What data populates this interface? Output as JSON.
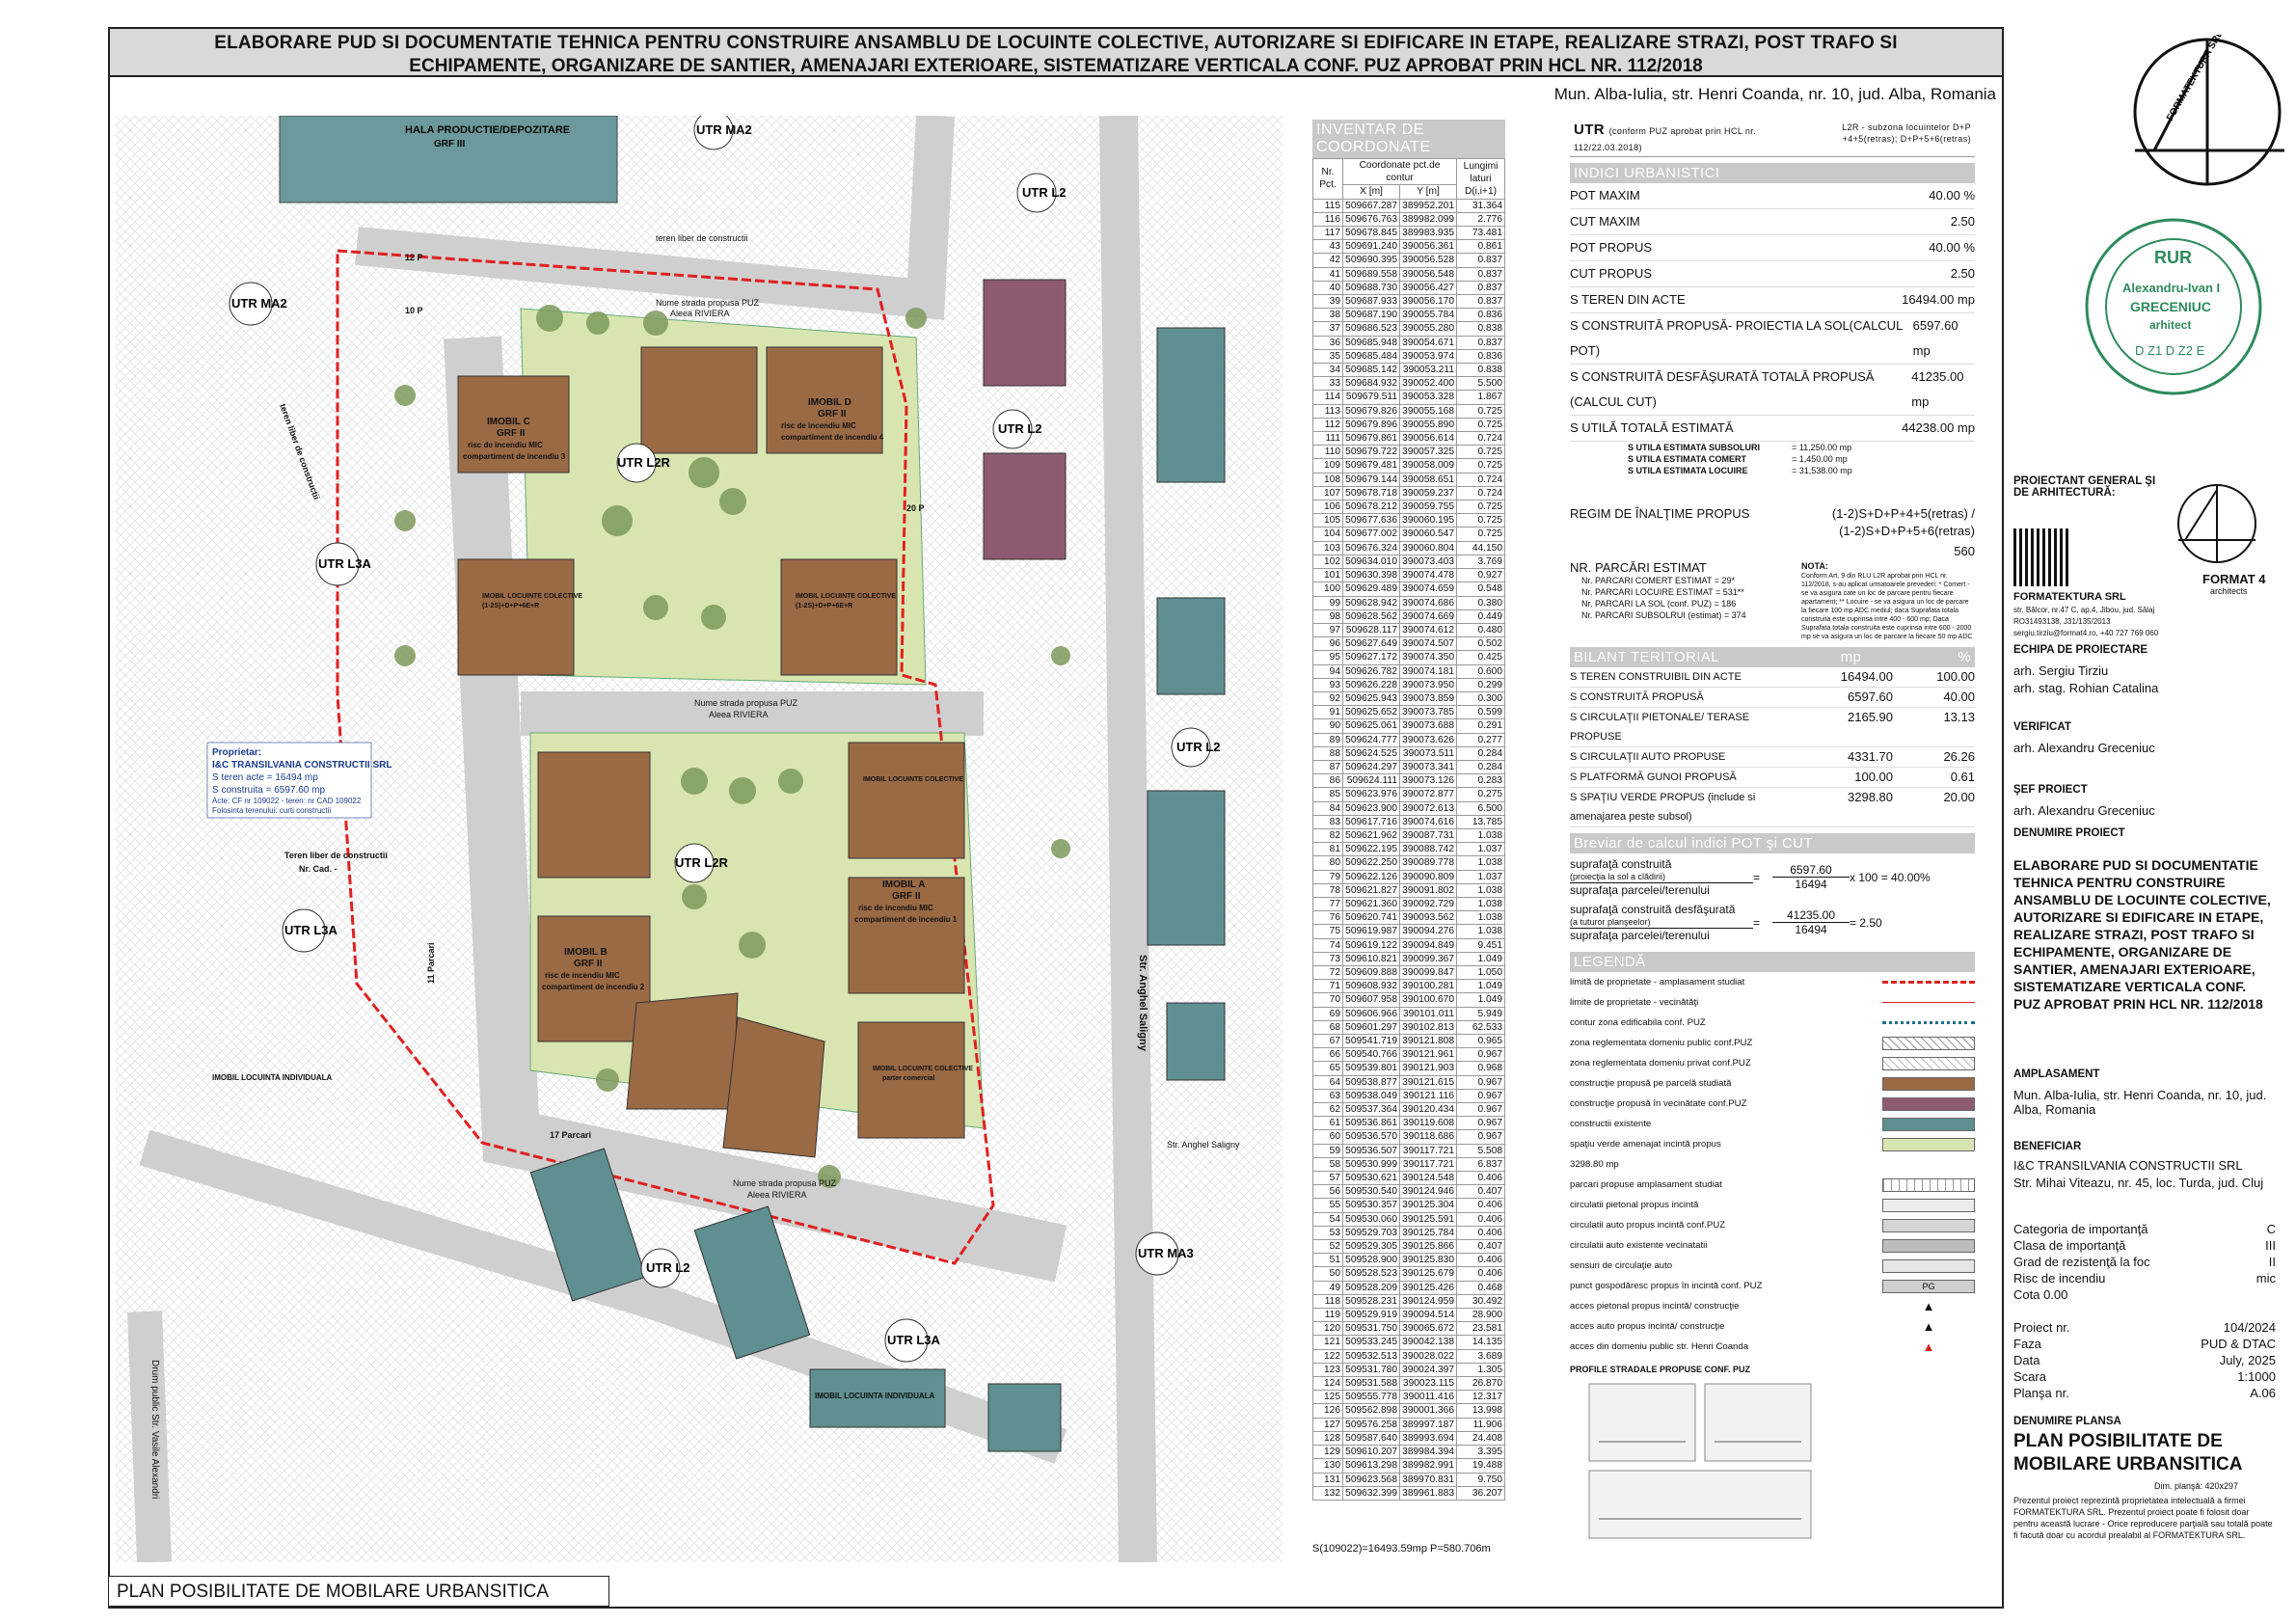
{
  "header": {
    "line1": "ELABORARE PUD SI DOCUMENTATIE TEHNICA PENTRU CONSTRUIRE ANSAMBLU DE LOCUINTE COLECTIVE, AUTORIZARE SI EDIFICARE IN ETAPE, REALIZARE STRAZI, POST TRAFO SI",
    "line2": "ECHIPAMENTE, ORGANIZARE DE SANTIER, AMENAJARI EXTERIOARE, SISTEMATIZARE VERTICALA CONF. PUZ APROBAT PRIN HCL NR. 112/2018",
    "location": "Mun. Alba-Iulia, str. Henri Coanda, nr. 10, jud. Alba, Romania"
  },
  "map": {
    "labels": {
      "hala": "HALA PRODUCTIE/DEPOZITARE",
      "hala_grf": "GRF III",
      "utr_ma2_top": "UTR MA2",
      "utr_ma2_left": "UTR MA2",
      "utr_l2_top": "UTR L2",
      "utr_l2_mid": "UTR L2",
      "utr_l2_right": "UTR L2",
      "utr_l2_bottom": "UTR L2",
      "utr_l3a_left": "UTR L3A",
      "utr_l3a_mid": "UTR L3A",
      "utr_l3a_bottom": "UTR L3A",
      "utr_ma3": "UTR MA3",
      "utr_l2r_top": "UTR L2R",
      "utr_l2r_bottom": "UTR L2R",
      "teren_liber_top": "teren liber de constructii",
      "teren_liber_left": "teren liber de constructii",
      "teren_liber_mid": "Teren liber de constructii",
      "nr_cad": "Nr. Cad. -",
      "strada_propusa_1": "Nume strada propusa PUZ",
      "alee_riviera_1": "Aleea RIVIERA",
      "strada_propusa_2": "Nume strada propusa PUZ",
      "alee_riviera_2": "Aleea RIVIERA",
      "strada_propusa_3": "Nume strada propusa PUZ",
      "alee_riviera_3": "Aleea RIVIERA",
      "str_anghel": "Str. Anghel Saligny",
      "str_anghel_2": "Str. Anghel Saligny",
      "drum_public": "Drum public Str. Vasile Alexandri",
      "imobil_c": "IMOBIL C",
      "imobil_d": "IMOBIL D",
      "imobil_b": "IMOBIL B",
      "imobil_a": "IMOBIL A",
      "grf2": "GRF II",
      "risc": "risc de incendiu MIC",
      "comp3": "compartiment de incendiu 3",
      "comp4": "compartiment de incendiu 4",
      "comp2": "compartiment de incendiu 2",
      "comp1": "compartiment de incendiu 1",
      "imobil_locuinte": "IMOBIL LOCUINTE COLECTIVE",
      "regim": "(1-2S)+D+P+6E+R",
      "parter_comercial": "parter comercial",
      "imobil_ind": "IMOBIL LOCUINTA INDIVIDUALA",
      "proprietar_title": "Proprietar:",
      "proprietar_name": "I&C TRANSILVANIA CONSTRUCTII SRL",
      "proprietar_s_teren": "S teren acte = 16494 mp",
      "proprietar_s_construita": "S construita = 6597.60 mp",
      "proprietar_cf": "Acte: CF nr 109022 - teren: nr CAD 109022",
      "proprietar_folosinta": "Folosinta terenului: curti constructii",
      "p12": "12 P",
      "p10": "10 P",
      "p20": "20 P",
      "p11": "11 Parcari",
      "p17": "17 Parcari"
    }
  },
  "coord": {
    "title": "INVENTAR DE COORDONATE",
    "h_nr": "Nr. Pct.",
    "h_coord": "Coordonate pct.de contur",
    "h_x": "X [m]",
    "h_y": "Y [m]",
    "h_len": "Lungimi laturi D(i,i+1)",
    "rows": [
      [
        "115",
        "509667.287",
        "389952.201",
        "31.364"
      ],
      [
        "116",
        "509676.763",
        "389982.099",
        "2.776"
      ],
      [
        "117",
        "509678.845",
        "389983.935",
        "73.481"
      ],
      [
        "43",
        "509691.240",
        "390056.361",
        "0.861"
      ],
      [
        "42",
        "509690.395",
        "390056.528",
        "0.837"
      ],
      [
        "41",
        "509689.558",
        "390056.548",
        "0.837"
      ],
      [
        "40",
        "509688.730",
        "390056.427",
        "0.837"
      ],
      [
        "39",
        "509687.933",
        "390056.170",
        "0.837"
      ],
      [
        "38",
        "509687.190",
        "390055.784",
        "0.836"
      ],
      [
        "37",
        "509686.523",
        "390055.280",
        "0.838"
      ],
      [
        "36",
        "509685.948",
        "390054.671",
        "0.837"
      ],
      [
        "35",
        "509685.484",
        "390053.974",
        "0.836"
      ],
      [
        "34",
        "509685.142",
        "390053.211",
        "0.838"
      ],
      [
        "33",
        "509684.932",
        "390052.400",
        "5.500"
      ],
      [
        "114",
        "509679.511",
        "390053.328",
        "1.867"
      ],
      [
        "113",
        "509679.826",
        "390055.168",
        "0.725"
      ],
      [
        "112",
        "509679.896",
        "390055.890",
        "0.725"
      ],
      [
        "111",
        "509679.861",
        "390056.614",
        "0.724"
      ],
      [
        "110",
        "509679.722",
        "390057.325",
        "0.725"
      ],
      [
        "109",
        "509679.481",
        "390058.009",
        "0.725"
      ],
      [
        "108",
        "509679.144",
        "390058.651",
        "0.724"
      ],
      [
        "107",
        "509678.718",
        "390059.237",
        "0.724"
      ],
      [
        "106",
        "509678.212",
        "390059.755",
        "0.725"
      ],
      [
        "105",
        "509677.636",
        "390060.195",
        "0.725"
      ],
      [
        "104",
        "509677.002",
        "390060.547",
        "0.725"
      ],
      [
        "103",
        "509676.324",
        "390060.804",
        "44.150"
      ],
      [
        "102",
        "509634.010",
        "390073.403",
        "3.769"
      ],
      [
        "101",
        "509630.398",
        "390074.478",
        "0.927"
      ],
      [
        "100",
        "509629.489",
        "390074.659",
        "0.548"
      ],
      [
        "99",
        "509628.942",
        "390074.686",
        "0.380"
      ],
      [
        "98",
        "509628.562",
        "390074.669",
        "0.449"
      ],
      [
        "97",
        "509628.117",
        "390074.612",
        "0.480"
      ],
      [
        "96",
        "509627.649",
        "390074.507",
        "0.502"
      ],
      [
        "95",
        "509627.172",
        "390074.350",
        "0.425"
      ],
      [
        "94",
        "509626.782",
        "390074.181",
        "0.600"
      ],
      [
        "93",
        "509626.228",
        "390073.950",
        "0.299"
      ],
      [
        "92",
        "509625.943",
        "390073.859",
        "0.300"
      ],
      [
        "91",
        "509625.652",
        "390073.785",
        "0.599"
      ],
      [
        "90",
        "509625.061",
        "390073.688",
        "0.291"
      ],
      [
        "89",
        "509624.777",
        "390073.626",
        "0.277"
      ],
      [
        "88",
        "509624.525",
        "390073.511",
        "0.284"
      ],
      [
        "87",
        "509624.297",
        "390073.341",
        "0.284"
      ],
      [
        "86",
        "509624.111",
        "390073.126",
        "0.283"
      ],
      [
        "85",
        "509623.976",
        "390072.877",
        "0.275"
      ],
      [
        "84",
        "509623.900",
        "390072.613",
        "6.500"
      ],
      [
        "83",
        "509617.716",
        "390074.616",
        "13.785"
      ],
      [
        "82",
        "509621.962",
        "390087.731",
        "1.038"
      ],
      [
        "81",
        "509622.195",
        "390088.742",
        "1.037"
      ],
      [
        "80",
        "509622.250",
        "390089.778",
        "1.038"
      ],
      [
        "79",
        "509622.126",
        "390090.809",
        "1.037"
      ],
      [
        "78",
        "509621.827",
        "390091.802",
        "1.038"
      ],
      [
        "77",
        "509621.360",
        "390092.729",
        "1.038"
      ],
      [
        "76",
        "509620.741",
        "390093.562",
        "1.038"
      ],
      [
        "75",
        "509619.987",
        "390094.276",
        "1.038"
      ],
      [
        "74",
        "509619.122",
        "390094.849",
        "9.451"
      ],
      [
        "73",
        "509610.821",
        "390099.367",
        "1.049"
      ],
      [
        "72",
        "509609.888",
        "390099.847",
        "1.050"
      ],
      [
        "71",
        "509608.932",
        "390100.281",
        "1.049"
      ],
      [
        "70",
        "509607.958",
        "390100.670",
        "1.049"
      ],
      [
        "69",
        "509606.966",
        "390101.011",
        "5.949"
      ],
      [
        "68",
        "509601.297",
        "390102.813",
        "62.533"
      ],
      [
        "67",
        "509541.719",
        "390121.808",
        "0.965"
      ],
      [
        "66",
        "509540.766",
        "390121.961",
        "0.967"
      ],
      [
        "65",
        "509539.801",
        "390121.903",
        "0.968"
      ],
      [
        "64",
        "509538.877",
        "390121.615",
        "0.967"
      ],
      [
        "63",
        "509538.049",
        "390121.116",
        "0.967"
      ],
      [
        "62",
        "509537.364",
        "390120.434",
        "0.967"
      ],
      [
        "61",
        "509536.861",
        "390119.608",
        "0.967"
      ],
      [
        "60",
        "509536.570",
        "390118.686",
        "0.967"
      ],
      [
        "59",
        "509536.507",
        "390117.721",
        "5.508"
      ],
      [
        "58",
        "509530.999",
        "390117.721",
        "6.837"
      ],
      [
        "57",
        "509530.621",
        "390124.548",
        "0.406"
      ],
      [
        "56",
        "509530.540",
        "390124.946",
        "0.407"
      ],
      [
        "55",
        "509530.357",
        "390125.304",
        "0.406"
      ],
      [
        "54",
        "509530.060",
        "390125.591",
        "0.406"
      ],
      [
        "53",
        "509529.703",
        "390125.784",
        "0.406"
      ],
      [
        "52",
        "509529.305",
        "390125.866",
        "0.407"
      ],
      [
        "51",
        "509528.900",
        "390125.830",
        "0.406"
      ],
      [
        "50",
        "509528.523",
        "390125.679",
        "0.406"
      ],
      [
        "49",
        "509528.209",
        "390125.426",
        "0.468"
      ],
      [
        "118",
        "509528.231",
        "390124.959",
        "30.492"
      ],
      [
        "119",
        "509529.919",
        "390094.514",
        "28.900"
      ],
      [
        "120",
        "509531.750",
        "390065.672",
        "23.581"
      ],
      [
        "121",
        "509533.245",
        "390042.138",
        "14.135"
      ],
      [
        "122",
        "509532.513",
        "390028.022",
        "3.689"
      ],
      [
        "123",
        "509531.780",
        "390024.397",
        "1.305"
      ],
      [
        "124",
        "509531.588",
        "390023.115",
        "26.870"
      ],
      [
        "125",
        "509555.778",
        "390011.416",
        "12.317"
      ],
      [
        "126",
        "509562.898",
        "390001.366",
        "13.998"
      ],
      [
        "127",
        "509576.258",
        "389997.187",
        "11.906"
      ],
      [
        "128",
        "509587.640",
        "389993.694",
        "24.408"
      ],
      [
        "129",
        "509610.207",
        "389984.394",
        "3.395"
      ],
      [
        "130",
        "509613.298",
        "389982.991",
        "19.488"
      ],
      [
        "131",
        "509623.568",
        "389970.831",
        "9.750"
      ],
      [
        "132",
        "509632.399",
        "389961.883",
        "36.207"
      ]
    ],
    "footer": "S(109022)=16493.59mp  P=580.706m"
  },
  "utr": {
    "label": "UTR",
    "note": "(conform PUZ aprobat prin HCL nr. 112/22.03.2018)",
    "value": "L2R - subzona locuintelor D+P +4+5(retras); D+P+5+6(retras)"
  },
  "indici": {
    "title": "INDICI URBANISTICI",
    "rows": [
      {
        "k": "POT MAXIM",
        "v": "40.00 %"
      },
      {
        "k": "CUT MAXIM",
        "v": "2.50"
      },
      {
        "k": "POT PROPUS",
        "v": "40.00 %"
      },
      {
        "k": "CUT PROPUS",
        "v": "2.50"
      },
      {
        "k": "S TEREN DIN ACTE",
        "v": "16494.00 mp"
      },
      {
        "k": "S CONSTRUITĂ PROPUSĂ- PROIECTIA LA SOL(CALCUL POT)",
        "v": "6597.60 mp"
      },
      {
        "k": "S CONSTRUITĂ DESFĂŞURATĂ TOTALĂ PROPUSĂ (CALCUL CUT)",
        "v": "41235.00 mp"
      },
      {
        "k": "S UTILĂ TOTALĂ ESTIMATĂ",
        "v": "44238.00 mp"
      }
    ],
    "sub": [
      {
        "k": "S UTILA ESTIMATA SUBSOLURI",
        "v": "= 11,250.00 mp"
      },
      {
        "k": "S UTILA ESTIMATA COMERT",
        "v": "= 1,450.00 mp"
      },
      {
        "k": "S UTILA ESTIMATA LOCUIRE",
        "v": "= 31,538.00 mp"
      }
    ],
    "regim_label": "REGIM DE ÎNALŢIME PROPUS",
    "regim_v1": "(1-2)S+D+P+4+5(retras) /",
    "regim_v2": "(1-2)S+D+P+5+6(retras)",
    "parcari_total": "560",
    "parcari_label": "NR. PARCĂRI ESTIMAT",
    "parcari_rows": [
      "Nr. PARCARI COMERT ESTIMAT = 29*",
      "Nr. PARCARI LOCUIRE ESTIMAT = 531**",
      "Nr. PARCARI LA SOL (conf. PUZ) = 186",
      "Nr. PARCARI SUBSOLRUI (estimat) = 374"
    ],
    "nota_title": "NOTA:",
    "nota": "Conform Art. 9 din RLU L2R aprobat prin HCL nr. 112/2018, s-au aplicat urmatoarele prevederi: * Comert - se va asigura cate un loc de parcare pentru fiecare apartament; ** Locuire - se va asigura un loc de parcare la fiecare 100 mp ADC mediul; daca Suprafata totala construita este cuprinsa intre 400 - 600 mp; Daca Suprafata totala construita este cuprinsa intre 600 - 2000 mp se va asigura un loc de parcare la fiecare 50 mp ADC"
  },
  "bilant": {
    "title": "BILANT TERITORIAL",
    "h_mp": "mp",
    "h_pct": "%",
    "rows": [
      {
        "k": "S TEREN CONSTRUIBIL DIN ACTE",
        "mp": "16494.00",
        "p": "100.00"
      },
      {
        "k": "S CONSTRUITĂ PROPUSĂ",
        "mp": "6597.60",
        "p": "40.00"
      },
      {
        "k": "S CIRCULAŢII PIETONALE/ TERASE PROPUSE",
        "mp": "2165.90",
        "p": "13.13"
      },
      {
        "k": "S CIRCULAŢII AUTO PROPUSE",
        "mp": "4331.70",
        "p": "26.26"
      },
      {
        "k": "S PLATFORMĂ GUNOI PROPUSĂ",
        "mp": "100.00",
        "p": "0.61"
      },
      {
        "k": "S SPAŢIU VERDE PROPUS (include si amenajarea peste subsol)",
        "mp": "3298.80",
        "p": "20.00"
      }
    ]
  },
  "breviar": {
    "title": "Breviar de calcul indici POT şi CUT",
    "pot_num_label": "suprafaţă construită",
    "pot_num_sub": "(proiecţia la sol a clădirii)",
    "pot_den_label": "suprafaţa parcelei/terenului",
    "pot_num": "6597.60",
    "pot_den": "16494",
    "pot_result": "x 100 = 40.00%",
    "cut_num_label": "suprafaţă construită desfăşurată",
    "cut_num_sub": "(a tuturor planşeelor)",
    "cut_den_label": "suprafaţa parcelei/terenului",
    "cut_num": "41235.00",
    "cut_den": "16494",
    "cut_result": "= 2.50"
  },
  "legenda": {
    "title": "LEGENDĂ",
    "items": [
      "limită de proprietate - amplasament studiat",
      "limite de proprietate - vecinătăţi",
      "contur zona edificabila conf. PUZ",
      "zona reglementata domeniu public conf.PUZ",
      "zona reglementata domeniu privat conf.PUZ",
      "construcţie propusă pe parcelă studiată",
      "construcţie propusă în vecinătate conf.PUZ",
      "constructii existente",
      "spaţiu verde amenajat incintă propus",
      "3298.80 mp",
      "parcari propuse amplasament studiat",
      "circulatii pietonal propus incintă",
      "circulatii auto propus incintă conf.PUZ",
      "circulatii auto existente vecinatatii",
      "sensuri de circulaţie auto",
      "punct gospodăresc propus în incintă conf. PUZ",
      "acces pietonal propus incintă/ construcţie",
      "acces auto propus incintă/ construcţie",
      "acces din domeniu public str. Henri Coanda"
    ],
    "pg": "PG",
    "profile_title": "PROFILE STRADALE PROPUSE CONF. PUZ"
  },
  "titleblock": {
    "logo_text": "FORMATEKTURA SRL",
    "stamp_top": "RUR",
    "stamp_name1": "Alexandru-Ivan I",
    "stamp_name2": "GRECENIUC",
    "stamp_role": "arhitect",
    "stamp_code": "D Z1 D Z2 E",
    "proiectant_label": "PROIECTANT GENERAL ŞI DE ARHITECTURĂ:",
    "company": "FORMATEKTURA SRL",
    "company_addr": "str. Bălcor, nr.47 C, ap.4, Jibou, jud. Sălaj",
    "company_ro": "RO31493138, J31/135/2013",
    "company_contact": "sergiu.tirziu@format4.ro, +40 727 769 060",
    "format4": "FORMAT 4",
    "architects": "architects",
    "echipa_label": "ECHIPA DE PROIECTARE",
    "echipa1": "arh. Sergiu Tirziu",
    "echipa2": "arh. stag. Rohian Catalina",
    "verificat_label": "VERIFICAT",
    "verificat": "arh. Alexandru Greceniuc",
    "sef_label": "ŞEF PROIECT",
    "sef": "arh. Alexandru Greceniuc",
    "denumire_label": "DENUMIRE PROIECT",
    "denumire": "ELABORARE PUD SI DOCUMENTATIE TEHNICA PENTRU CONSTRUIRE ANSAMBLU DE LOCUINTE COLECTIVE, AUTORIZARE SI EDIFICARE IN ETAPE, REALIZARE STRAZI, POST TRAFO SI ECHIPAMENTE, ORGANIZARE DE SANTIER, AMENAJARI EXTERIOARE, SISTEMATIZARE VERTICALA CONF. PUZ APROBAT PRIN HCL NR. 112/2018",
    "amplasament_label": "AMPLASAMENT",
    "amplasament": "Mun. Alba-Iulia, str. Henri Coanda, nr. 10, jud. Alba, Romania",
    "beneficiar_label": "BENEFICIAR",
    "beneficiar": "I&C TRANSILVANIA CONSTRUCTII SRL",
    "beneficiar_addr": "Str. Mihai Viteazu, nr. 45, loc. Turda, jud. Cluj",
    "kv1": [
      {
        "k": "Categoria de importanţă",
        "v": "C"
      },
      {
        "k": "Clasa de importanţă",
        "v": "III"
      },
      {
        "k": "Grad de rezistenţă la foc",
        "v": "II"
      },
      {
        "k": "Risc de incendiu",
        "v": "mic"
      },
      {
        "k": "Cota 0.00",
        "v": ""
      }
    ],
    "kv2": [
      {
        "k": "Proiect nr.",
        "v": "104/2024"
      },
      {
        "k": "Faza",
        "v": "PUD & DTAC"
      },
      {
        "k": "Data",
        "v": "July, 2025"
      },
      {
        "k": "Scara",
        "v": "1:1000"
      },
      {
        "k": "Planşa nr.",
        "v": "A.06"
      }
    ],
    "denumire_plansa_label": "DENUMIRE PLANSA",
    "plansa": "PLAN POSIBILITATE DE MOBILARE URBANSITICA",
    "dim": "Dim. planşă: 420x297",
    "copyright": "Prezentul proiect reprezintă proprietatea intelectuală a firmei FORMATEKTURA SRL. Prezentul proiect poate fi folosit doar pentru această lucrare - Orice reproducere parţială sau totală poate fi facută doar cu acordul prealabil al FORMATEKTURA SRL."
  },
  "footer_title": "PLAN POSIBILITATE DE MOBILARE URBANSITICA",
  "colors": {
    "building": "#9a6a45",
    "neighbour": "#8e5a72",
    "existing": "#5f8f91",
    "green": "#d9e5b0",
    "tree": "#7c9a5c",
    "road": "#d6d6d6",
    "limit": "#e02020",
    "section_header": "#c9c9c9"
  }
}
